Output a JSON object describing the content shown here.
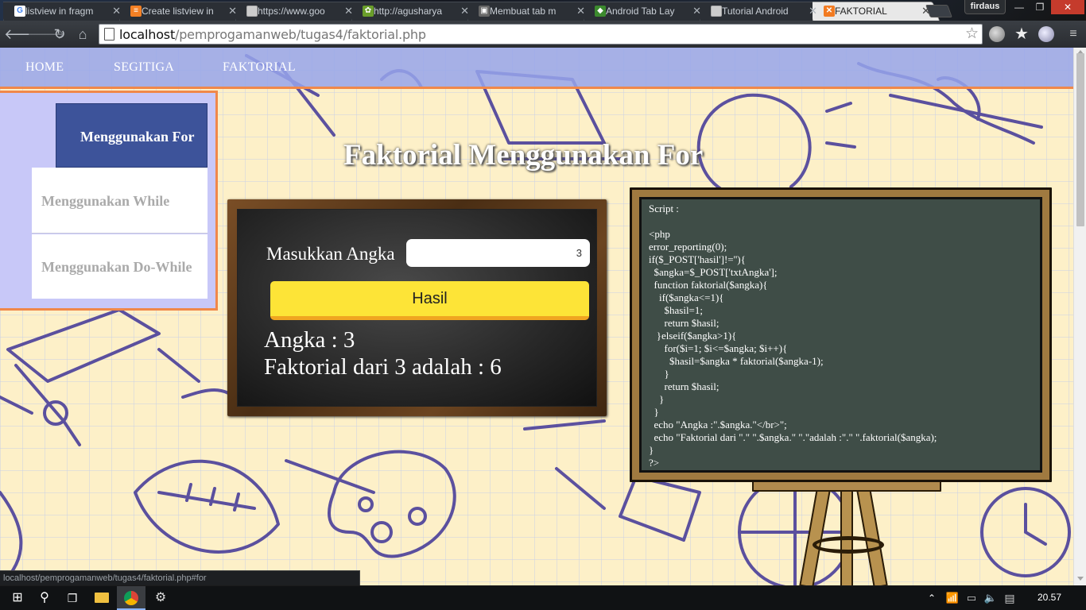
{
  "browser": {
    "tabs": [
      {
        "title": "listview in fragm",
        "icon": "google-icon",
        "active": false
      },
      {
        "title": "Create listview in",
        "icon": "stackoverflow-icon",
        "active": false
      },
      {
        "title": "https://www.goo",
        "icon": "page-icon",
        "active": false
      },
      {
        "title": "http://agusharya",
        "icon": "gear-favicon",
        "active": false
      },
      {
        "title": "Membuat tab m",
        "icon": "blog-icon",
        "active": false
      },
      {
        "title": "Android Tab Lay",
        "icon": "android-icon",
        "active": false
      },
      {
        "title": "Tutorial Android",
        "icon": "page-icon",
        "active": false
      },
      {
        "title": "FAKTORIAL",
        "icon": "xampp-icon",
        "active": true
      }
    ],
    "profile_name": "firdaus",
    "url_host": "localhost",
    "url_path": "/pemprogamanweb/tugas4/faktorial.php",
    "status_url": "localhost/pemprogamanweb/tugas4/faktorial.php#for"
  },
  "nav": {
    "items": [
      "HOME",
      "SEGITIGA",
      "FAKTORIAL"
    ]
  },
  "sidebar": {
    "items": [
      "Menggunakan For",
      "Menggunakan While",
      "Menggunakan Do-While"
    ]
  },
  "main": {
    "title": "Faktorial Menggunakan For",
    "input_label": "Masukkan Angka",
    "input_value": "3",
    "button_label": "Hasil",
    "result_angka": "Angka : 3",
    "result_faktorial": "Faktorial dari 3 adalah : 6"
  },
  "code": {
    "lines": [
      "Script :",
      "",
      "<php",
      "error_reporting(0);",
      "if($_POST['hasil']!=''){",
      "  $angka=$_POST['txtAngka'];",
      "  function faktorial($angka){",
      "    if($angka<=1){",
      "      $hasil=1;",
      "      return $hasil;",
      "   }elseif($angka>1){",
      "      for($i=1; $i<=$angka; $i++){",
      "        $hasil=$angka * faktorial($angka-1);",
      "      }",
      "      return $hasil;",
      "    }",
      "  }",
      "  echo \"Angka :\".$angka.\"</br>\";",
      "  echo \"Faktorial dari \".\" \".$angka.\" \".\"adalah :\".\" \".faktorial($angka);",
      "}",
      "?>"
    ]
  },
  "taskbar": {
    "time": "20.57"
  },
  "colors": {
    "navbar": "#96a5eb",
    "accent_border": "#f0884a",
    "sidebar_active": "#3d539a",
    "button_yellow": "#fde437",
    "codeboard_bg": "#3f4d47"
  }
}
